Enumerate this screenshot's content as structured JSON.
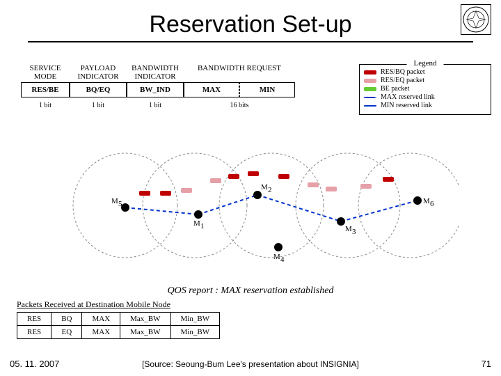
{
  "title": "Reservation Set-up",
  "packet": {
    "headers": [
      "SERVICE MODE",
      "PAYLOAD INDICATOR",
      "BANDWIDTH INDICATOR",
      "BANDWIDTH REQUEST"
    ],
    "row_values": [
      "RES/BE",
      "BQ/EQ",
      "BW_IND",
      "MAX",
      "MIN"
    ],
    "bitrow": [
      "1 bit",
      "1 bit",
      "1 bit",
      "16 bits"
    ]
  },
  "legend": {
    "title": "Legend",
    "items": [
      {
        "color": "#c00000",
        "label": "RES/BQ packet"
      },
      {
        "color": "#e6a0a8",
        "label": "RES/EQ packet"
      },
      {
        "color": "#66cc33",
        "label": "BE        packet"
      },
      {
        "color": "dashed-blue",
        "label": "MAX reserved link"
      },
      {
        "color": "solid-blue",
        "label": "MIN reserved link"
      }
    ]
  },
  "nodes": [
    "M5",
    "M1",
    "M2",
    "M3",
    "M6",
    "M4"
  ],
  "qos_report": "QOS report : MAX reservation established",
  "received": {
    "title": "Packets Received at Destination Mobile Node",
    "rows": [
      [
        "RES",
        "BQ",
        "MAX",
        "Max_BW",
        "Min_BW"
      ],
      [
        "RES",
        "EQ",
        "MAX",
        "Max_BW",
        "Min_BW"
      ]
    ]
  },
  "footer": {
    "date": "05. 11. 2007",
    "source": "[Source: Seoung-Bum Lee's presentation about INSIGNIA]",
    "page": "71"
  },
  "colors": {
    "red": "#c00000",
    "pink": "#e6a0a8",
    "green": "#66cc33",
    "blue": "#0033cc"
  }
}
